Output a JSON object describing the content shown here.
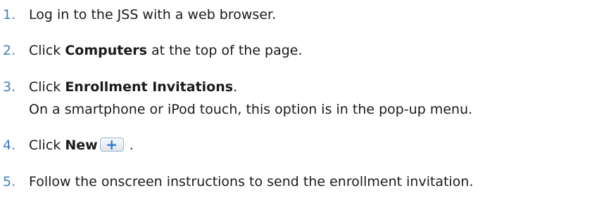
{
  "steps": [
    {
      "number": "1.",
      "text": "Log in to the JSS with a web browser."
    },
    {
      "number": "2.",
      "pre": "Click ",
      "bold": "Computers",
      "post": " at the top of the page."
    },
    {
      "number": "3.",
      "pre": "Click ",
      "bold": "Enrollment Invitations",
      "post": ".",
      "note": "On a smartphone or iPod touch, this option is in the pop-up menu."
    },
    {
      "number": "4.",
      "pre": "Click ",
      "bold": "New",
      "button_symbol": "+",
      "post": " ."
    },
    {
      "number": "5.",
      "text": "Follow the onscreen instructions to send the enrollment invitation."
    }
  ],
  "colors": {
    "number": "#3f7fbf",
    "text": "#1a1a1a"
  },
  "icons": {
    "new_button": "plus-icon"
  }
}
